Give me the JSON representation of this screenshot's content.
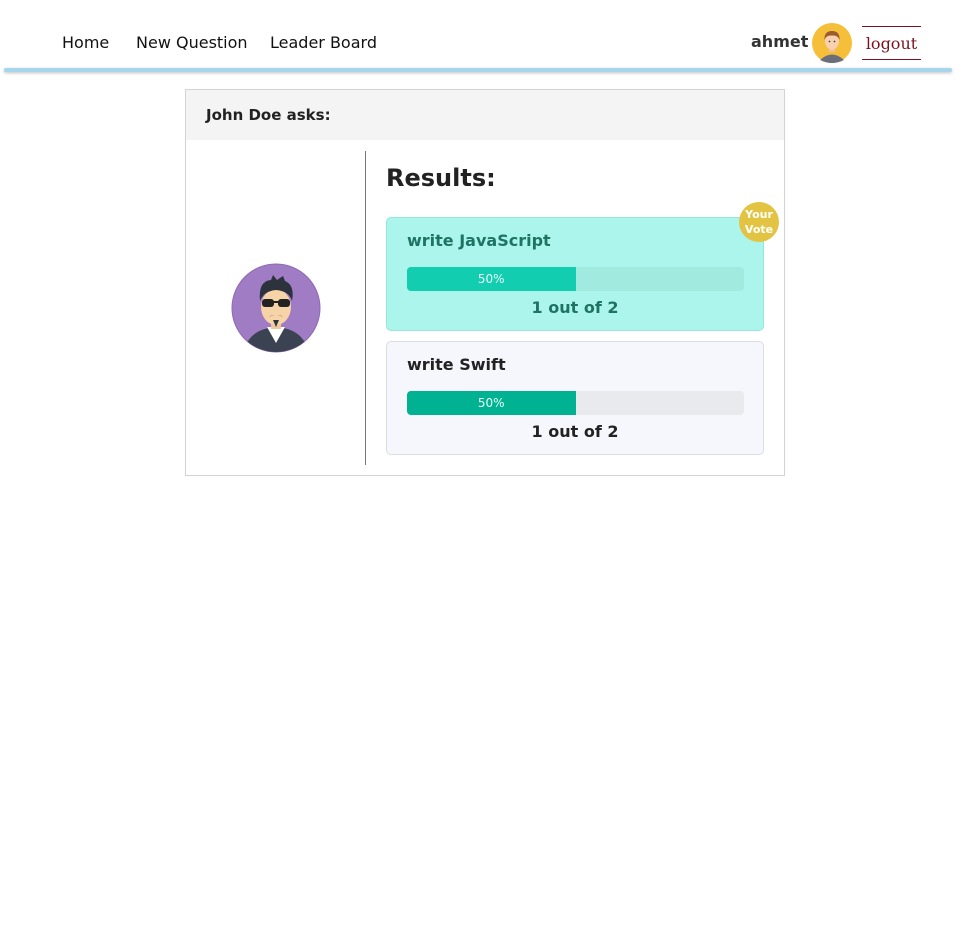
{
  "nav": {
    "links": [
      {
        "label": "Home"
      },
      {
        "label": "New Question"
      },
      {
        "label": "Leader Board"
      }
    ],
    "username": "ahmet",
    "logout_label": "logout"
  },
  "question": {
    "header": "John Doe asks:",
    "results_title": "Results:",
    "options": [
      {
        "text": "write JavaScript",
        "percent_label": "50%",
        "percent": 50,
        "count_label": "1 out of 2",
        "voted": true
      },
      {
        "text": "write Swift",
        "percent_label": "50%",
        "percent": 50,
        "count_label": "1 out of 2",
        "voted": false
      }
    ],
    "your_vote_badge": {
      "line1": "Your",
      "line2": "Vote"
    }
  },
  "colors": {
    "nav_underline": "#a6d5ee",
    "logout": "#7a1020",
    "voted_bg": "#acf5ec",
    "voted_bar": "#13cdb0",
    "other_bar": "#00b292",
    "badge": "#e3c442"
  }
}
